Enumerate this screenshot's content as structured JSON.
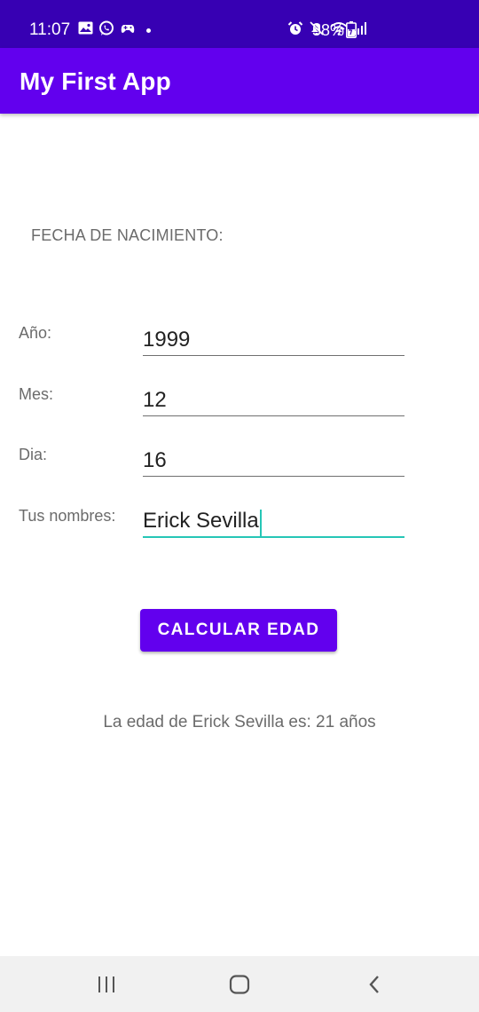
{
  "status_bar": {
    "time": "11:07",
    "battery": "58%",
    "left_icons": [
      "image-icon",
      "whatsapp-icon",
      "game-controller-icon",
      "notification-dot-icon"
    ],
    "right_icons": [
      "alarm-icon",
      "mute-icon",
      "wifi-icon",
      "signal-icon",
      "battery-icon"
    ]
  },
  "app_bar": {
    "title": "My First App"
  },
  "form": {
    "section_label": "FECHA DE NACIMIENTO:",
    "fields": [
      {
        "label": "Año:",
        "value": "1999"
      },
      {
        "label": "Mes:",
        "value": "12"
      },
      {
        "label": "Dia:",
        "value": "16"
      },
      {
        "label": "Tus nombres:",
        "value": "Erick Sevilla"
      }
    ],
    "button_label": "CALCULAR EDAD",
    "result": "La edad de Erick Sevilla es: 21 años"
  },
  "colors": {
    "status_bar": "#3700b3",
    "primary": "#6200ee",
    "focus_underline": "#26c6b6"
  },
  "nav_bar": {
    "icons": [
      "recent-apps-icon",
      "home-icon",
      "back-icon"
    ]
  }
}
